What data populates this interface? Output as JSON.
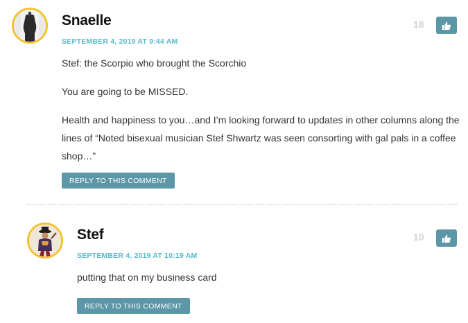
{
  "comments": [
    {
      "author": "Snaelle",
      "date": "SEPTEMBER 4, 2019 AT 9:44 AM",
      "likes": "18",
      "paragraphs": [
        "Stef: the Scorpio who brought the Scorchio",
        "You are going to be MISSED.",
        "Health and happiness to you…and I’m looking forward to updates in other columns along the lines of “Noted bisexual musician Stef Shwartz was seen consorting with gal pals in a coffee shop…”"
      ],
      "reply_label": "REPLY TO THIS COMMENT",
      "like_icon": "thumbs-up-icon",
      "avatar": "mannequin-avatar"
    },
    {
      "author": "Stef",
      "date": "SEPTEMBER 4, 2019 AT 10:19 AM",
      "likes": "10",
      "paragraphs": [
        "putting that on my business card"
      ],
      "reply_label": "REPLY TO THIS COMMENT",
      "like_icon": "thumbs-up-icon",
      "avatar": "costumed-figure-avatar"
    }
  ],
  "colors": {
    "accent": "#54b8cc",
    "button": "#5c97a8",
    "avatar_border": "#f2c230",
    "likes": "#d4d4d4"
  }
}
